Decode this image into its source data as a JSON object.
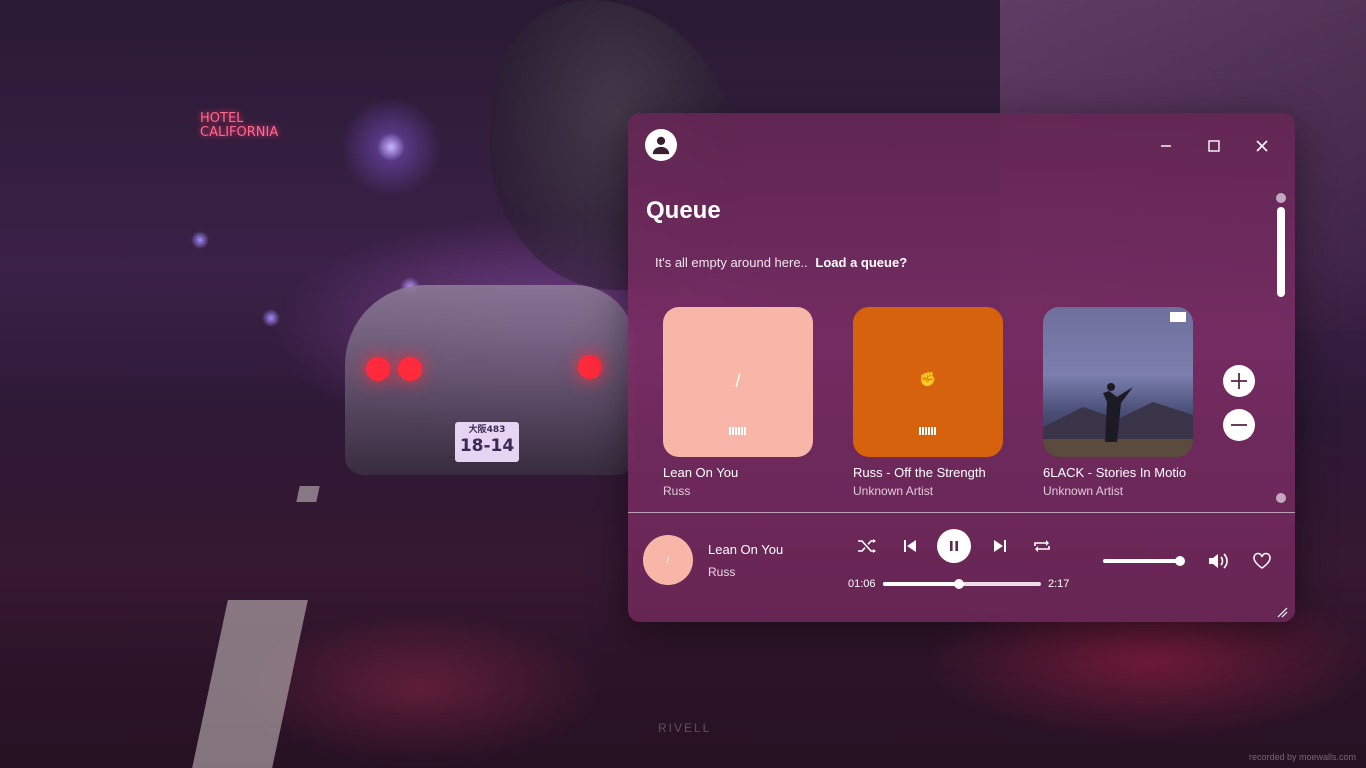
{
  "background": {
    "sign_text": "HOTEL CALIFORNIA",
    "plate_line1": "大阪483",
    "plate_line2": "18-14",
    "logo_text": "RIVELL",
    "watermark": "recorded by moewalls.com"
  },
  "window": {
    "controls": {
      "minimize": "minimize",
      "maximize": "maximize",
      "close": "close"
    }
  },
  "queue": {
    "title": "Queue",
    "empty_text": "It's all empty around here..",
    "load_link": "Load a queue?",
    "items": [
      {
        "title": "Lean On You",
        "subtitle": "Russ",
        "art_color": "#f7b6a8",
        "art_mark": "/"
      },
      {
        "title": "Russ - Off the Strength",
        "subtitle": "Unknown Artist",
        "art_color": "#d7620d",
        "art_mark": "✊"
      },
      {
        "title": "6LACK - Stories In Motio",
        "subtitle": "Unknown Artist",
        "art_color": "#5a5f8a",
        "art_mark": ""
      }
    ]
  },
  "player": {
    "now_playing_title": "Lean On You",
    "now_playing_artist": "Russ",
    "current_time": "01:06",
    "total_time": "2:17",
    "progress_fraction": 0.48,
    "volume_fraction": 0.95
  },
  "colors": {
    "accent": "#ffffff",
    "window_bg": "#782d64"
  }
}
